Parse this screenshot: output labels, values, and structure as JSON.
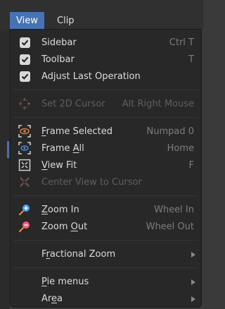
{
  "menubar": {
    "tabs": [
      "View",
      "Clip"
    ]
  },
  "menu": {
    "items": [
      {
        "label": "Sidebar",
        "shortcut": "Ctrl T",
        "checked": true
      },
      {
        "label": "Toolbar",
        "shortcut": "T",
        "checked": true
      },
      {
        "label": "Adjust Last Operation",
        "shortcut": "",
        "checked": true
      },
      {
        "label": "Set 2D Cursor",
        "shortcut": "Alt Right Mouse",
        "icon": "cursor-target-icon",
        "disabled": true
      },
      {
        "label_pre": "",
        "label_ul": "F",
        "label_post": "rame Selected",
        "shortcut": "Numpad 0",
        "icon": "frame-selected-icon"
      },
      {
        "label_pre": "Frame ",
        "label_ul": "A",
        "label_post": "ll",
        "shortcut": "Home",
        "icon": "frame-all-icon"
      },
      {
        "label_pre": "",
        "label_ul": "V",
        "label_post": "iew Fit",
        "shortcut": "F",
        "icon": "view-fit-icon"
      },
      {
        "label": "Center View to Cursor",
        "shortcut": "",
        "icon": "center-view-icon",
        "disabled": true
      },
      {
        "label_pre": "",
        "label_ul": "Z",
        "label_post": "oom In",
        "shortcut": "Wheel In",
        "icon": "zoom-in-icon"
      },
      {
        "label_pre": "Zoom ",
        "label_ul": "O",
        "label_post": "ut",
        "shortcut": "Wheel Out",
        "icon": "zoom-out-icon"
      },
      {
        "label_pre": "F",
        "label_ul": "r",
        "label_post": "actional Zoom",
        "submenu": true
      },
      {
        "label_pre": "",
        "label_ul": "P",
        "label_post": "ie menus",
        "submenu": true
      },
      {
        "label_pre": "Ar",
        "label_ul": "e",
        "label_post": "a",
        "submenu": true
      }
    ]
  },
  "colors": {
    "accent": "#4772b3",
    "menu_bg": "#282828",
    "zoom_in": "#4aa0ff",
    "zoom_out": "#ff5a7a",
    "cursor_red": "#e04444"
  }
}
